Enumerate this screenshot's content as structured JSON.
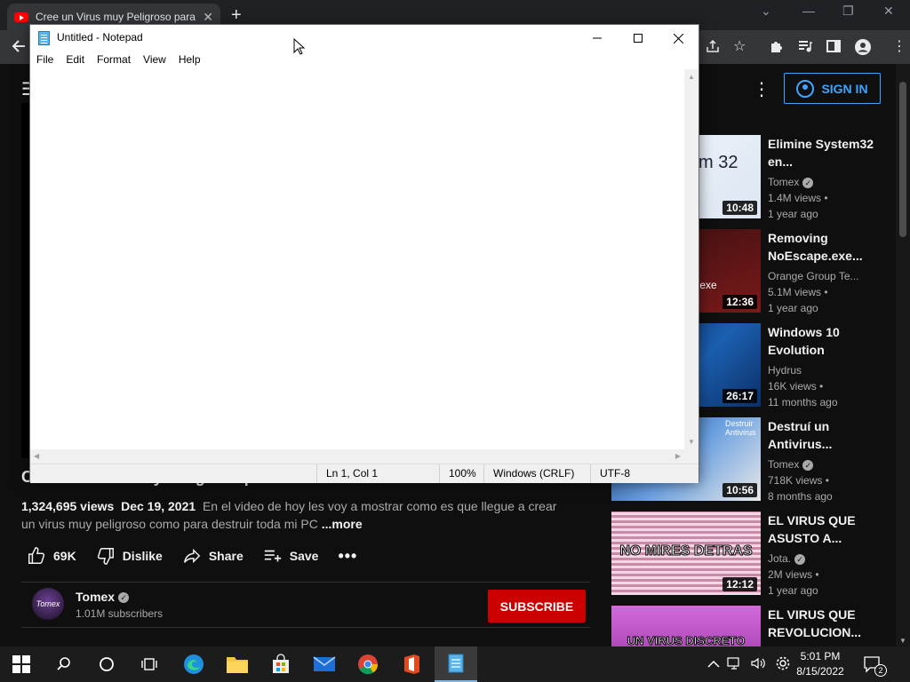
{
  "browser": {
    "tab_title": "Cree un Virus muy Peligroso para",
    "tab_close": "✕",
    "new_tab": "+"
  },
  "youtube": {
    "sign_in": "SIGN IN",
    "video_title": "Cree un Virus muy Peligroso para destruir mi PC",
    "views": "1,324,695 views",
    "date": "Dec 19, 2021",
    "description": "En el video de hoy les voy a mostrar como es que llegue a crear un virus muy peligroso como para destruir toda mi PC",
    "more": "...more",
    "likes": "69K",
    "dislike": "Dislike",
    "share": "Share",
    "save": "Save",
    "channel_name": "Tomex",
    "channel_avatar_text": "Tomex",
    "subscribers": "1.01M subscribers",
    "subscribe": "SUBSCRIBE",
    "related": [
      {
        "title": "Elimine System32 en...",
        "channel": "Tomex",
        "verified": true,
        "views": "1.4M views •",
        "age": "1 year ago",
        "duration": "10:48",
        "thumb_text": "m 32"
      },
      {
        "title": "Removing NoEscape.exe...",
        "channel": "Orange Group Te...",
        "verified": false,
        "views": "5.1M views •",
        "age": "1 year ago",
        "duration": "12:36",
        "thumb_text": ".exe"
      },
      {
        "title": "Windows 10 Evolution",
        "channel": "Hydrus",
        "verified": false,
        "views": "16K views •",
        "age": "11 months ago",
        "duration": "26:17",
        "thumb_text": ""
      },
      {
        "title": "Destruí un Antivirus...",
        "channel": "Tomex",
        "verified": true,
        "views": "718K views •",
        "age": "8 months ago",
        "duration": "10:56",
        "thumb_text": "Destruir Antivirus"
      },
      {
        "title": "EL VIRUS QUE ASUSTO A...",
        "channel": "Jota.",
        "verified": true,
        "views": "2M views •",
        "age": "1 year ago",
        "duration": "12:12",
        "thumb_text": "NO MIRES DETRAS"
      },
      {
        "title": "EL VIRUS QUE REVOLUCION...",
        "channel": "",
        "verified": false,
        "views": "",
        "age": "",
        "duration": "",
        "thumb_text": "UN VIRUS DISCRETO"
      }
    ]
  },
  "notepad": {
    "title": "Untitled - Notepad",
    "menu": [
      "File",
      "Edit",
      "Format",
      "View",
      "Help"
    ],
    "content": "",
    "status": {
      "position": "Ln 1, Col 1",
      "zoom": "100%",
      "line_ending": "Windows (CRLF)",
      "encoding": "UTF-8"
    }
  },
  "taskbar": {
    "time": "5:01 PM",
    "date": "8/15/2022",
    "notifications": "2"
  },
  "colors": {
    "youtube_red": "#cc0000",
    "signin_blue": "#3ea6ff",
    "taskbar": "#1c1c1c"
  }
}
